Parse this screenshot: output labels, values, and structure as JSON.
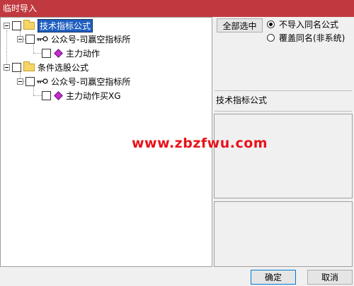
{
  "window": {
    "title": "临时导入"
  },
  "tree": {
    "nodes": [
      {
        "label": "技术指标公式"
      },
      {
        "label": "公众号-司赢空指标所"
      },
      {
        "label": "主力动作"
      },
      {
        "label": "条件选股公式"
      },
      {
        "label": "公众号-司赢空指标所"
      },
      {
        "label": "主力动作买XG"
      }
    ]
  },
  "options": {
    "select_all": "全部选中",
    "radio_skip": "不导入同名公式",
    "radio_overwrite": "覆盖同名(非系统)",
    "selected": "radio_skip"
  },
  "info": {
    "text": "技术指标公式"
  },
  "watermark": "www.zbzfwu.com",
  "footer": {
    "ok": "确定",
    "cancel": "取消"
  }
}
